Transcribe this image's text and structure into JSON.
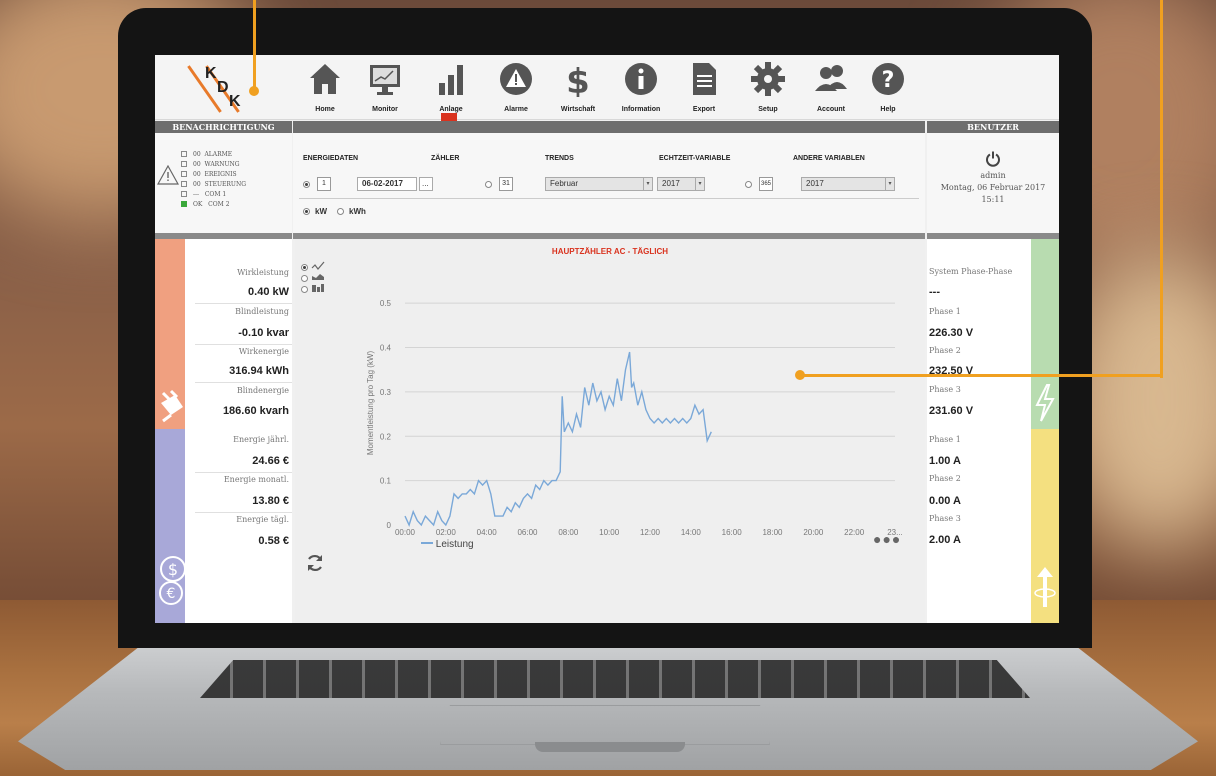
{
  "nav": {
    "items": [
      {
        "label": "Home",
        "icon": "home-icon"
      },
      {
        "label": "Monitor",
        "icon": "monitor-icon"
      },
      {
        "label": "Anlage",
        "icon": "bar-chart-icon"
      },
      {
        "label": "Alarme",
        "icon": "alarm-icon"
      },
      {
        "label": "Wirtschaft",
        "icon": "dollar-icon"
      },
      {
        "label": "Information",
        "icon": "info-icon"
      },
      {
        "label": "Export",
        "icon": "document-icon"
      },
      {
        "label": "Setup",
        "icon": "gear-icon"
      },
      {
        "label": "Account",
        "icon": "users-icon"
      },
      {
        "label": "Help",
        "icon": "help-icon"
      }
    ]
  },
  "logo": {
    "letters": [
      "K",
      "D",
      "K"
    ]
  },
  "notifications": {
    "header": "BENACHRICHTIGUNG",
    "rows": [
      {
        "count": "00",
        "label": "ALARME"
      },
      {
        "count": "00",
        "label": "WARNUNG"
      },
      {
        "count": "00",
        "label": "EREIGNIS"
      },
      {
        "count": "00",
        "label": "STEUERUNG"
      },
      {
        "count": "---",
        "label": "COM 1"
      },
      {
        "count": "OK",
        "label": "COM 2"
      }
    ]
  },
  "user": {
    "header": "BENUTZER",
    "name": "admin",
    "date": "Montag, 06 Februar 2017",
    "time": "15:11"
  },
  "controls": {
    "tabs": [
      "ENERGIEDATEN",
      "ZÄHLER",
      "TRENDS",
      "ECHTZEIT-VARIABLE",
      "ANDERE VARIABLEN"
    ],
    "cal_day": "1",
    "date_value": "06-02-2017",
    "date_button": "...",
    "cal_month": "31",
    "month_value": "Februar",
    "year_value": "2017",
    "cal_year": "365",
    "year_value_2": "2017",
    "unit_kw": "kW",
    "unit_kwh": "kWh"
  },
  "left_stats": [
    {
      "label": "Wirkleistung",
      "value": "0.40 kW"
    },
    {
      "label": "Blindleistung",
      "value": "-0.10 kvar"
    },
    {
      "label": "Wirkenergie",
      "value": "316.94 kWh"
    },
    {
      "label": "Blindenergie",
      "value": "186.60 kvarh"
    },
    {
      "label": "Energie jährl.",
      "value": "24.66 €"
    },
    {
      "label": "Energie monatl.",
      "value": "13.80 €"
    },
    {
      "label": "Energie tägl.",
      "value": "0.58 €"
    }
  ],
  "right_stats": {
    "title": "System Phase-Phase",
    "dash": "---",
    "voltage": [
      {
        "label": "Phase 1",
        "value": "226.30 V"
      },
      {
        "label": "Phase 2",
        "value": "232.50 V"
      },
      {
        "label": "Phase 3",
        "value": "231.60 V"
      }
    ],
    "current": [
      {
        "label": "Phase 1",
        "value": "1.00 A"
      },
      {
        "label": "Phase 2",
        "value": "0.00 A"
      },
      {
        "label": "Phase 3",
        "value": "2.00 A"
      }
    ]
  },
  "colors": {
    "accent_orange": "#f0a020",
    "strip_salmon": "#f0a080",
    "strip_lavender": "#a8a8d8",
    "strip_green": "#b8dcb0",
    "strip_yellow": "#f4e080",
    "line_blue": "#7aa8d8",
    "title_red": "#d9321e"
  },
  "chart_data": {
    "type": "line",
    "title": "HAUPTZÄHLER AC - TÄGLICH",
    "ylabel": "Momentleistung pro Tag (kW)",
    "xlabel": "",
    "x_ticks": [
      "00:00",
      "02:00",
      "04:00",
      "06:00",
      "08:00",
      "10:00",
      "12:00",
      "14:00",
      "16:00",
      "18:00",
      "20:00",
      "22:00",
      "23..."
    ],
    "y_ticks": [
      "0",
      "0.1",
      "0.2",
      "0.3",
      "0.4",
      "0.5"
    ],
    "ylim": [
      0,
      0.55
    ],
    "xlim": [
      0,
      24
    ],
    "grid": true,
    "legend": "bottom-left",
    "series": [
      {
        "name": "Leistung",
        "x": [
          0.0,
          0.2,
          0.4,
          0.6,
          0.8,
          1.0,
          1.2,
          1.4,
          1.6,
          1.8,
          2.0,
          2.2,
          2.4,
          2.6,
          2.8,
          3.0,
          3.2,
          3.4,
          3.6,
          3.8,
          4.0,
          4.2,
          4.4,
          4.6,
          4.8,
          5.0,
          5.2,
          5.4,
          5.6,
          5.8,
          6.0,
          6.2,
          6.4,
          6.6,
          6.8,
          7.0,
          7.2,
          7.4,
          7.6,
          7.7,
          7.8,
          8.0,
          8.2,
          8.4,
          8.6,
          8.8,
          9.0,
          9.2,
          9.4,
          9.6,
          9.8,
          10.0,
          10.2,
          10.4,
          10.6,
          10.8,
          11.0,
          11.1,
          11.2,
          11.4,
          11.6,
          11.8,
          12.0,
          12.2,
          12.4,
          12.6,
          12.8,
          13.0,
          13.2,
          13.4,
          13.6,
          13.8,
          14.0,
          14.2,
          14.4,
          14.6,
          14.8,
          15.0
        ],
        "values": [
          0.02,
          0.0,
          0.03,
          0.01,
          0.0,
          0.02,
          0.01,
          0.0,
          0.03,
          0.01,
          0.0,
          0.02,
          0.07,
          0.06,
          0.07,
          0.07,
          0.08,
          0.07,
          0.1,
          0.09,
          0.1,
          0.07,
          0.02,
          0.02,
          0.02,
          0.04,
          0.03,
          0.05,
          0.04,
          0.06,
          0.07,
          0.06,
          0.09,
          0.08,
          0.1,
          0.09,
          0.1,
          0.1,
          0.12,
          0.29,
          0.21,
          0.23,
          0.21,
          0.25,
          0.22,
          0.31,
          0.27,
          0.32,
          0.28,
          0.3,
          0.26,
          0.29,
          0.27,
          0.33,
          0.28,
          0.35,
          0.39,
          0.31,
          0.32,
          0.27,
          0.3,
          0.26,
          0.24,
          0.23,
          0.24,
          0.23,
          0.24,
          0.23,
          0.24,
          0.23,
          0.24,
          0.23,
          0.24,
          0.27,
          0.25,
          0.26,
          0.19,
          0.21
        ]
      }
    ]
  }
}
